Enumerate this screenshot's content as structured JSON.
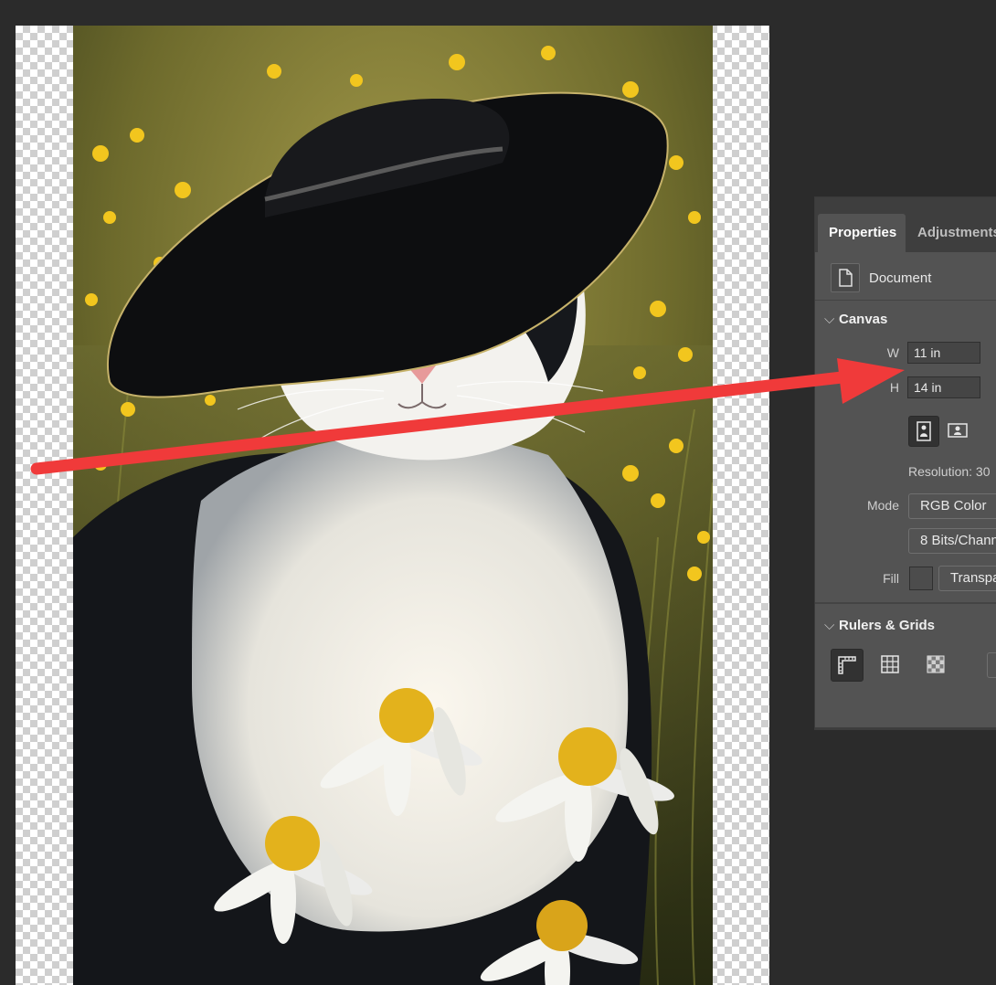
{
  "panel": {
    "tabs": [
      {
        "label": "Properties",
        "active": true
      },
      {
        "label": "Adjustments",
        "active": false
      }
    ],
    "document_label": "Document",
    "canvas": {
      "title": "Canvas",
      "width_label": "W",
      "width_value": "11 in",
      "height_label": "H",
      "height_value": "14 in",
      "orientation": "portrait",
      "resolution_text": "Resolution: 30",
      "mode_label": "Mode",
      "mode_value": "RGB Color",
      "bits_value": "8 Bits/Chann",
      "fill_label": "Fill",
      "fill_value": "Transpa"
    },
    "rulers": {
      "title": "Rulers & Grids"
    }
  },
  "icons": {
    "document": "document-icon",
    "portrait": "portrait-orientation-icon",
    "landscape": "landscape-orientation-icon",
    "ruler": "ruler-icon",
    "grid": "grid-icon",
    "transparency": "transparency-grid-icon"
  },
  "colors": {
    "annotation_arrow": "#f03a3a",
    "panel_bg": "#535353",
    "workspace_bg": "#2b2b2b"
  }
}
